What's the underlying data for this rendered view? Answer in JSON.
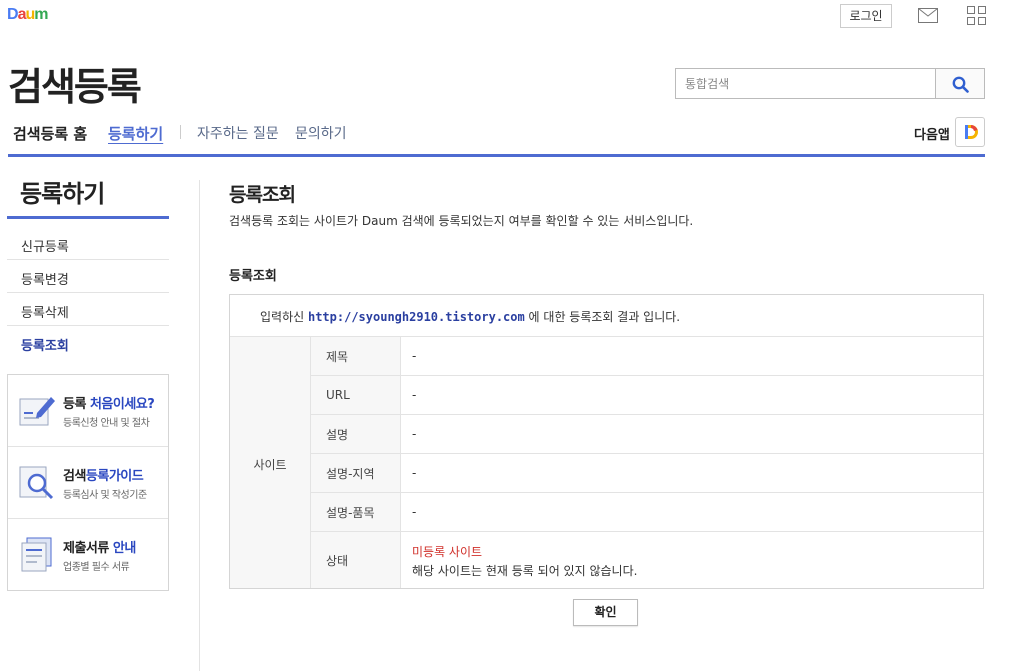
{
  "header": {
    "logo_parts": [
      "D",
      "a",
      "u",
      "m"
    ],
    "login_label": "로그인",
    "mail_icon": "mail-icon",
    "apps_icon": "apps-grid-icon",
    "site_title": "검색등록",
    "search": {
      "placeholder": "통합검색",
      "value": ""
    }
  },
  "gnb": {
    "home": "검색등록 홈",
    "items": [
      "등록하기",
      "자주하는 질문",
      "문의하기"
    ],
    "active": "등록하기",
    "app_label": "다음앱"
  },
  "sidebar": {
    "title": "등록하기",
    "menu": [
      "신규등록",
      "등록변경",
      "등록삭제",
      "등록조회"
    ],
    "active": "등록조회",
    "boxes": [
      {
        "title_pre": "등록 ",
        "title_em": "처음이세요?",
        "title_post": "",
        "sub": "등록신청 안내 및 절차",
        "icon": "pencil-icon"
      },
      {
        "title_pre": "검색",
        "title_em": "등록가이드",
        "title_post": "",
        "sub": "등록심사 및 작성기준",
        "icon": "magnifier-guide-icon"
      },
      {
        "title_pre": "제출서류 ",
        "title_em": "안내",
        "title_post": "",
        "sub": "업종별 필수 서류",
        "icon": "documents-icon"
      }
    ]
  },
  "content": {
    "title": "등록조회",
    "desc": "검색등록 조회는 사이트가 Daum 검색에 등록되었는지 여부를 확인할 수 있는 서비스입니다.",
    "subtitle": "등록조회",
    "result": {
      "intro_pre": "입력하신 ",
      "url": "http://syoungh2910.tistory.com",
      "intro_post": " 에 대한 등록조회 결과 입니다.",
      "site_label": "사이트",
      "rows": [
        {
          "label": "제목",
          "value": "-"
        },
        {
          "label": "URL",
          "value": "-"
        },
        {
          "label": "설명",
          "value": "-"
        },
        {
          "label": "설명-지역",
          "value": "-"
        },
        {
          "label": "설명-품목",
          "value": "-"
        }
      ],
      "status_label": "상태",
      "status_value": "미등록 사이트",
      "status_msg": "해당 사이트는 현재 등록 되어 있지 않습니다."
    },
    "confirm_label": "확인"
  },
  "colors": {
    "accent": "#4e6bd1",
    "link": "#2a3fa0",
    "danger": "#d0302a"
  }
}
